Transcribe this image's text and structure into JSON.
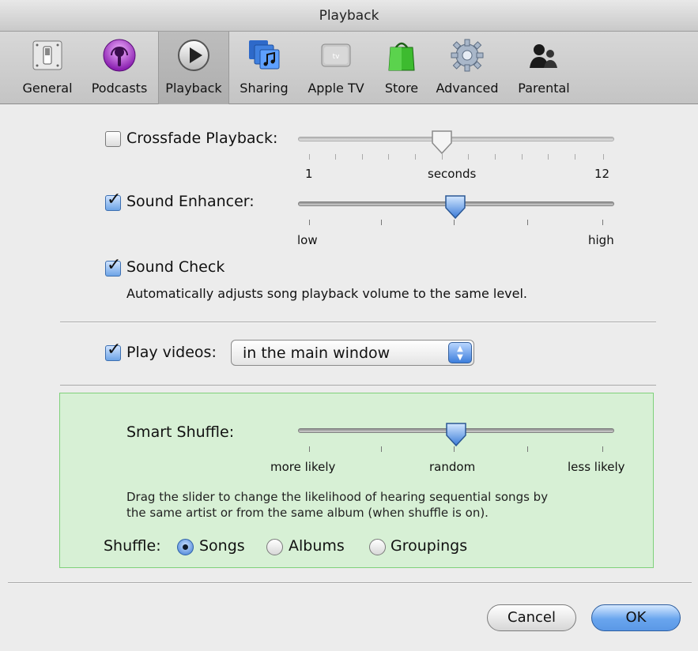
{
  "window": {
    "title": "Playback"
  },
  "toolbar": {
    "items": [
      {
        "label": "General",
        "icon": "general-switch-icon"
      },
      {
        "label": "Podcasts",
        "icon": "podcasts-icon"
      },
      {
        "label": "Playback",
        "icon": "play-icon",
        "active": true
      },
      {
        "label": "Sharing",
        "icon": "sharing-icon"
      },
      {
        "label": "Apple TV",
        "icon": "apple-tv-icon"
      },
      {
        "label": "Store",
        "icon": "store-bag-icon"
      },
      {
        "label": "Advanced",
        "icon": "gear-icon"
      },
      {
        "label": "Parental",
        "icon": "parental-icon"
      }
    ]
  },
  "crossfade": {
    "label": "Crossfade Playback:",
    "checked": false,
    "min_label": "1",
    "mid_label": "seconds",
    "max_label": "12"
  },
  "sound_enhancer": {
    "label": "Sound Enhancer:",
    "checked": true,
    "min_label": "low",
    "max_label": "high"
  },
  "sound_check": {
    "label": "Sound Check",
    "checked": true,
    "description": "Automatically adjusts song playback volume to the same level."
  },
  "play_videos": {
    "label": "Play videos:",
    "checked": true,
    "selected": "in the main window"
  },
  "smart_shuffle": {
    "label": "Smart Shuffle:",
    "left_label": "more likely",
    "mid_label": "random",
    "right_label": "less likely",
    "description_line1": "Drag the slider to change the likelihood of hearing sequential songs by",
    "description_line2": "the same artist or from the same album (when shuffle is on)."
  },
  "shuffle": {
    "label": "Shuffle:",
    "options": [
      "Songs",
      "Albums",
      "Groupings"
    ],
    "selected": "Songs"
  },
  "buttons": {
    "cancel": "Cancel",
    "ok": "OK"
  },
  "colors": {
    "accent_blue": "#5b98e6",
    "green_panel": "#d7f0d5",
    "green_border": "#7fd17b"
  }
}
